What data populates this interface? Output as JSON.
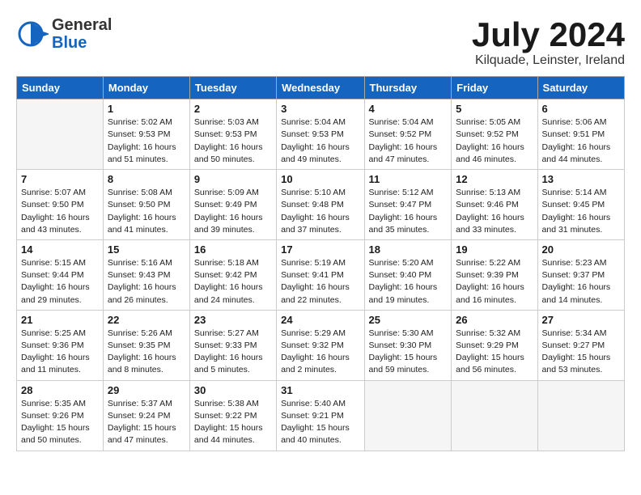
{
  "header": {
    "logo_general": "General",
    "logo_blue": "Blue",
    "title": "July 2024",
    "location": "Kilquade, Leinster, Ireland"
  },
  "calendar": {
    "days_of_week": [
      "Sunday",
      "Monday",
      "Tuesday",
      "Wednesday",
      "Thursday",
      "Friday",
      "Saturday"
    ],
    "weeks": [
      [
        {
          "day": "",
          "info": ""
        },
        {
          "day": "1",
          "info": "Sunrise: 5:02 AM\nSunset: 9:53 PM\nDaylight: 16 hours\nand 51 minutes."
        },
        {
          "day": "2",
          "info": "Sunrise: 5:03 AM\nSunset: 9:53 PM\nDaylight: 16 hours\nand 50 minutes."
        },
        {
          "day": "3",
          "info": "Sunrise: 5:04 AM\nSunset: 9:53 PM\nDaylight: 16 hours\nand 49 minutes."
        },
        {
          "day": "4",
          "info": "Sunrise: 5:04 AM\nSunset: 9:52 PM\nDaylight: 16 hours\nand 47 minutes."
        },
        {
          "day": "5",
          "info": "Sunrise: 5:05 AM\nSunset: 9:52 PM\nDaylight: 16 hours\nand 46 minutes."
        },
        {
          "day": "6",
          "info": "Sunrise: 5:06 AM\nSunset: 9:51 PM\nDaylight: 16 hours\nand 44 minutes."
        }
      ],
      [
        {
          "day": "7",
          "info": "Sunrise: 5:07 AM\nSunset: 9:50 PM\nDaylight: 16 hours\nand 43 minutes."
        },
        {
          "day": "8",
          "info": "Sunrise: 5:08 AM\nSunset: 9:50 PM\nDaylight: 16 hours\nand 41 minutes."
        },
        {
          "day": "9",
          "info": "Sunrise: 5:09 AM\nSunset: 9:49 PM\nDaylight: 16 hours\nand 39 minutes."
        },
        {
          "day": "10",
          "info": "Sunrise: 5:10 AM\nSunset: 9:48 PM\nDaylight: 16 hours\nand 37 minutes."
        },
        {
          "day": "11",
          "info": "Sunrise: 5:12 AM\nSunset: 9:47 PM\nDaylight: 16 hours\nand 35 minutes."
        },
        {
          "day": "12",
          "info": "Sunrise: 5:13 AM\nSunset: 9:46 PM\nDaylight: 16 hours\nand 33 minutes."
        },
        {
          "day": "13",
          "info": "Sunrise: 5:14 AM\nSunset: 9:45 PM\nDaylight: 16 hours\nand 31 minutes."
        }
      ],
      [
        {
          "day": "14",
          "info": "Sunrise: 5:15 AM\nSunset: 9:44 PM\nDaylight: 16 hours\nand 29 minutes."
        },
        {
          "day": "15",
          "info": "Sunrise: 5:16 AM\nSunset: 9:43 PM\nDaylight: 16 hours\nand 26 minutes."
        },
        {
          "day": "16",
          "info": "Sunrise: 5:18 AM\nSunset: 9:42 PM\nDaylight: 16 hours\nand 24 minutes."
        },
        {
          "day": "17",
          "info": "Sunrise: 5:19 AM\nSunset: 9:41 PM\nDaylight: 16 hours\nand 22 minutes."
        },
        {
          "day": "18",
          "info": "Sunrise: 5:20 AM\nSunset: 9:40 PM\nDaylight: 16 hours\nand 19 minutes."
        },
        {
          "day": "19",
          "info": "Sunrise: 5:22 AM\nSunset: 9:39 PM\nDaylight: 16 hours\nand 16 minutes."
        },
        {
          "day": "20",
          "info": "Sunrise: 5:23 AM\nSunset: 9:37 PM\nDaylight: 16 hours\nand 14 minutes."
        }
      ],
      [
        {
          "day": "21",
          "info": "Sunrise: 5:25 AM\nSunset: 9:36 PM\nDaylight: 16 hours\nand 11 minutes."
        },
        {
          "day": "22",
          "info": "Sunrise: 5:26 AM\nSunset: 9:35 PM\nDaylight: 16 hours\nand 8 minutes."
        },
        {
          "day": "23",
          "info": "Sunrise: 5:27 AM\nSunset: 9:33 PM\nDaylight: 16 hours\nand 5 minutes."
        },
        {
          "day": "24",
          "info": "Sunrise: 5:29 AM\nSunset: 9:32 PM\nDaylight: 16 hours\nand 2 minutes."
        },
        {
          "day": "25",
          "info": "Sunrise: 5:30 AM\nSunset: 9:30 PM\nDaylight: 15 hours\nand 59 minutes."
        },
        {
          "day": "26",
          "info": "Sunrise: 5:32 AM\nSunset: 9:29 PM\nDaylight: 15 hours\nand 56 minutes."
        },
        {
          "day": "27",
          "info": "Sunrise: 5:34 AM\nSunset: 9:27 PM\nDaylight: 15 hours\nand 53 minutes."
        }
      ],
      [
        {
          "day": "28",
          "info": "Sunrise: 5:35 AM\nSunset: 9:26 PM\nDaylight: 15 hours\nand 50 minutes."
        },
        {
          "day": "29",
          "info": "Sunrise: 5:37 AM\nSunset: 9:24 PM\nDaylight: 15 hours\nand 47 minutes."
        },
        {
          "day": "30",
          "info": "Sunrise: 5:38 AM\nSunset: 9:22 PM\nDaylight: 15 hours\nand 44 minutes."
        },
        {
          "day": "31",
          "info": "Sunrise: 5:40 AM\nSunset: 9:21 PM\nDaylight: 15 hours\nand 40 minutes."
        },
        {
          "day": "",
          "info": ""
        },
        {
          "day": "",
          "info": ""
        },
        {
          "day": "",
          "info": ""
        }
      ]
    ]
  }
}
